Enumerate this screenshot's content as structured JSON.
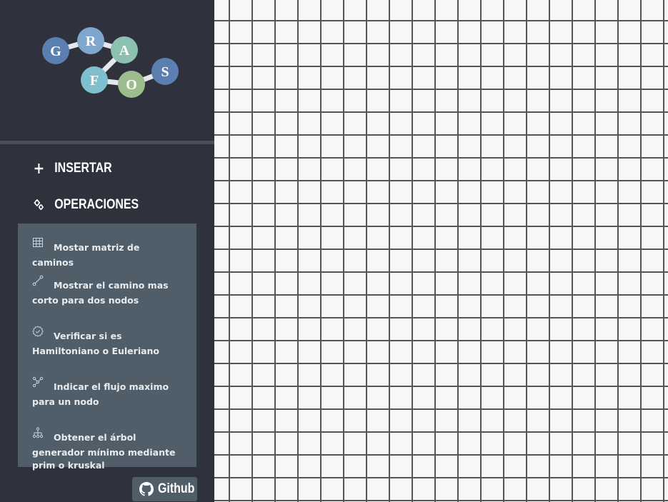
{
  "logo": {
    "letters": [
      "G",
      "R",
      "A",
      "F",
      "O",
      "S"
    ],
    "colors": {
      "G": "#5b7fb0",
      "R": "#7fa6cc",
      "A": "#8ec0b2",
      "F": "#7fc0d0",
      "O": "#9dbc8e",
      "S": "#5b7fb0"
    }
  },
  "menu": {
    "insertar": {
      "label": "INSERTAR",
      "icon": "plus-icon"
    },
    "operaciones": {
      "label": "OPERACIONES",
      "icon": "gears-icon"
    }
  },
  "operations": [
    {
      "label": "Mostar matriz de caminos",
      "icon": "table-grid-icon"
    },
    {
      "label": "Mostrar el camino mas corto para dos nodos",
      "icon": "path-icon"
    },
    {
      "label": "Verificar si es Hamiltoniano o Euleriano",
      "icon": "badge-check-icon"
    },
    {
      "label": "Indicar el flujo maximo para un nodo",
      "icon": "flow-nodes-icon"
    },
    {
      "label": "Obtener el árbol generador mínimo mediante prim o kruskal",
      "icon": "tree-hierarchy-icon"
    }
  ],
  "github": {
    "label": "Github",
    "icon": "github-icon"
  },
  "colors": {
    "sidebar": "#2f313d",
    "panel": "#4f5e68",
    "grid_line": "#555555",
    "canvas_bg": "#f7f7f7"
  }
}
